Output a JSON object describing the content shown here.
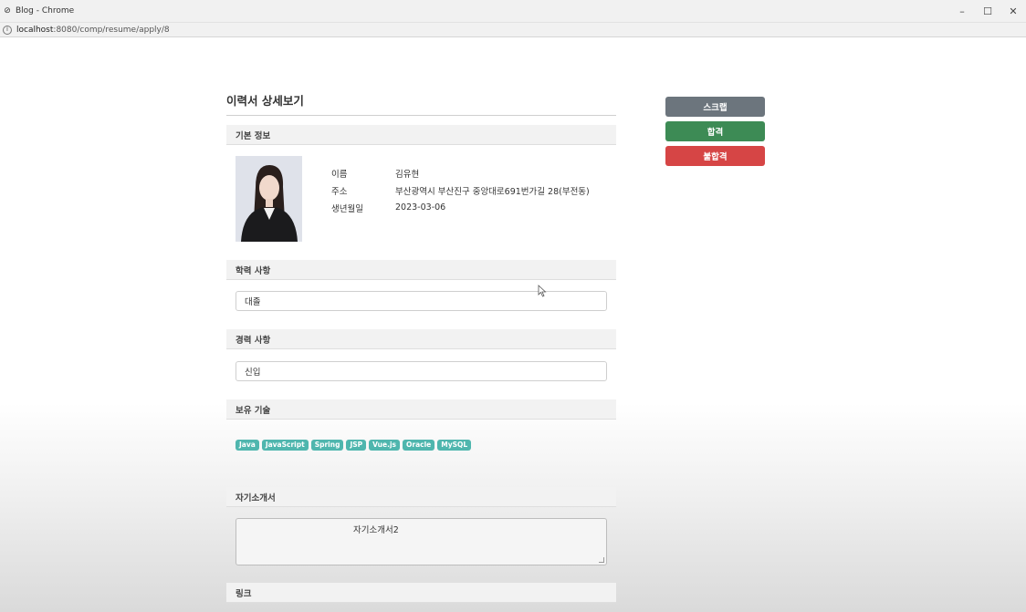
{
  "window": {
    "title": "Blog - Chrome",
    "minimize": "–",
    "maximize": "☐",
    "close": "✕"
  },
  "address": {
    "host": "localhost",
    "path": ":8080/comp/resume/apply/8"
  },
  "page": {
    "title": "이력서 상세보기"
  },
  "basic_info": {
    "header": "기본 정보",
    "rows": [
      {
        "label": "이름",
        "value": "김유현"
      },
      {
        "label": "주소",
        "value": "부산광역시 부산진구 중앙대로691번가길 28(부전동)"
      },
      {
        "label": "생년월일",
        "value": "2023-03-06"
      }
    ]
  },
  "education": {
    "header": "학력 사항",
    "value": "대졸"
  },
  "career": {
    "header": "경력 사항",
    "value": "신입"
  },
  "skills": {
    "header": "보유 기술",
    "items": [
      "Java",
      "JavaScript",
      "Spring",
      "JSP",
      "Vue.js",
      "Oracle",
      "MySQL"
    ]
  },
  "intro": {
    "header": "자기소개서",
    "value": "자기소개서2"
  },
  "link": {
    "header": "링크"
  },
  "actions": {
    "scrap": "스크랩",
    "pass": "합격",
    "fail": "불합격"
  },
  "colors": {
    "scrap": "#6c757d",
    "pass": "#3d8b55",
    "fail": "#d64545",
    "skill_badge": "#4fb6ae"
  }
}
